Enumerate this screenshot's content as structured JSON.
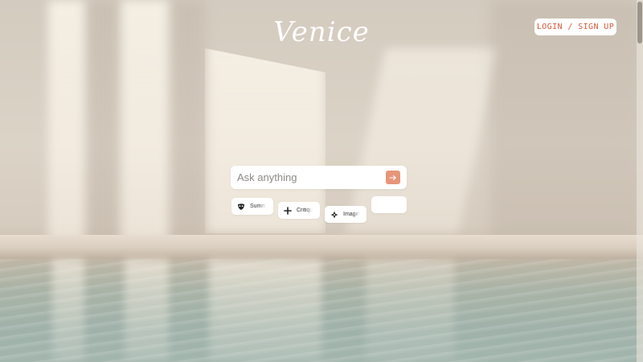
{
  "brand": {
    "logo_text": "Venice"
  },
  "header": {
    "login_label": "LOGIN / SIGN UP"
  },
  "search": {
    "placeholder": "Ask anything"
  },
  "suggestions": [
    {
      "label": "Summ",
      "icon": "mask-icon"
    },
    {
      "label": "Critiqu",
      "icon": "plus-icon"
    },
    {
      "label": "Imagin",
      "icon": "sparkle-icon"
    },
    {
      "label": "",
      "icon": ""
    }
  ],
  "colors": {
    "accent": "#d45a3a",
    "send_button": "#e7957a"
  }
}
